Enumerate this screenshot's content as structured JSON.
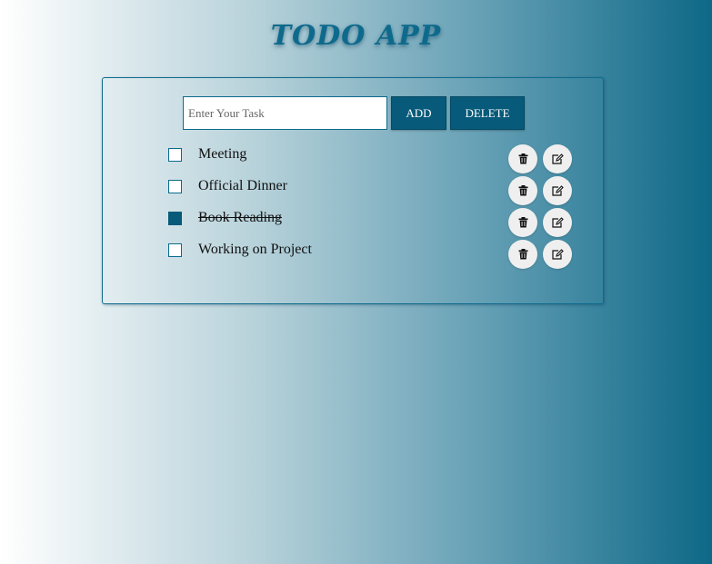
{
  "app": {
    "title": "TODO APP"
  },
  "form": {
    "input_placeholder": "Enter Your Task",
    "input_value": "",
    "add_label": "ADD",
    "delete_label": "DELETE"
  },
  "tasks": [
    {
      "label": "Meeting",
      "completed": false
    },
    {
      "label": "Official Dinner",
      "completed": false
    },
    {
      "label": "Book Reading",
      "completed": true
    },
    {
      "label": "Working on Project",
      "completed": false
    }
  ],
  "icons": {
    "delete": "trash-icon",
    "edit": "edit-icon"
  },
  "colors": {
    "accent": "#075a79",
    "title": "#0e6a8c",
    "gradient_start": "#ffffff",
    "gradient_end": "#0d6887"
  }
}
